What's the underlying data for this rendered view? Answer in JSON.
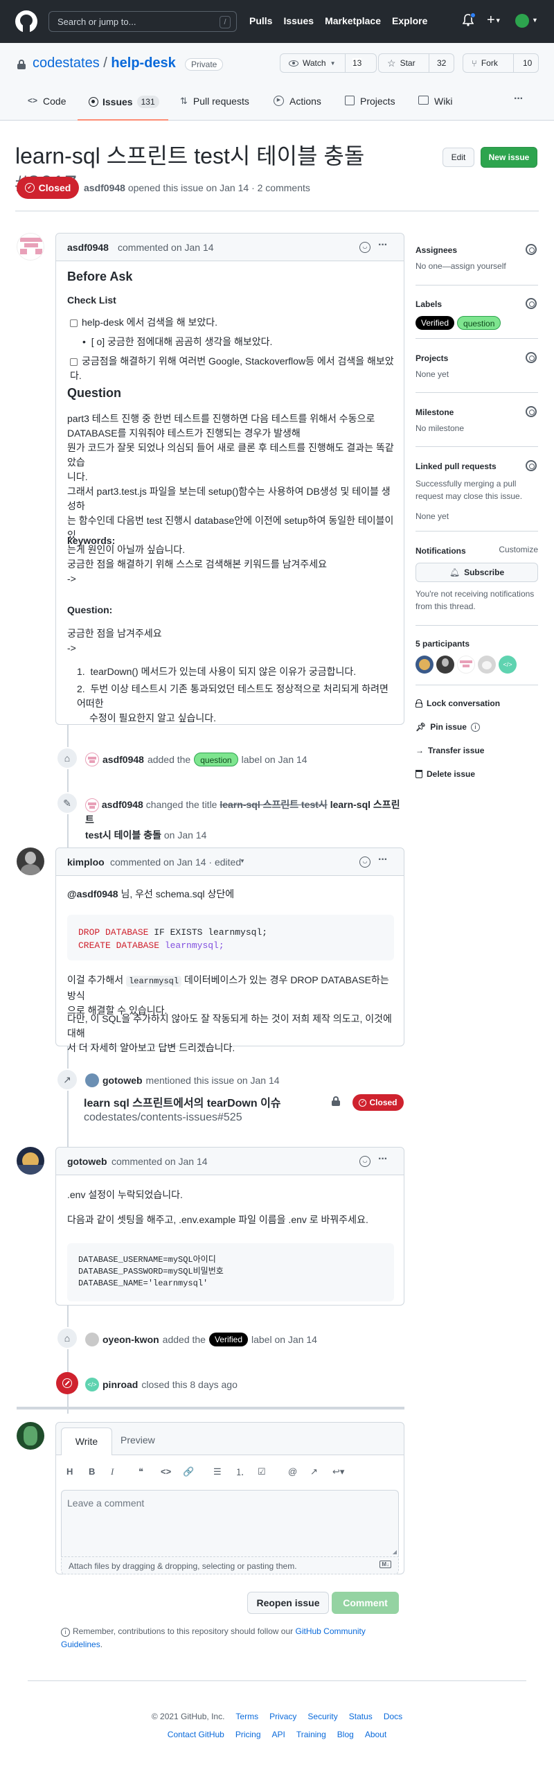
{
  "header": {
    "search_placeholder": "Search or jump to...",
    "slash": "/",
    "nav": [
      "Pulls",
      "Issues",
      "Marketplace",
      "Explore"
    ]
  },
  "repo": {
    "owner": "codestates",
    "separator": "/",
    "name": "help-desk",
    "visibility": "Private",
    "watch_label": "Watch",
    "watch_count": "13",
    "star_label": "Star",
    "star_count": "32",
    "fork_label": "Fork",
    "fork_count": "10"
  },
  "tabs": [
    {
      "label": "Code"
    },
    {
      "label": "Issues",
      "count": "131"
    },
    {
      "label": "Pull requests"
    },
    {
      "label": "Actions"
    },
    {
      "label": "Projects"
    },
    {
      "label": "Wiki"
    }
  ],
  "issue": {
    "title": "learn-sql 스프린트 test시 테이블 충돌",
    "number": "#2617",
    "edit_label": "Edit",
    "new_issue_label": "New issue",
    "state": "Closed",
    "author": "asdf0948",
    "meta": "opened this issue on Jan 14 · 2 comments"
  },
  "first_comment": {
    "author": "asdf0948",
    "when": "commented on Jan 14",
    "h_before": "Before Ask",
    "h_checklist": "Check List",
    "check1": "help-desk 에서 검색을 해 보았다.",
    "check2": "[ o] 궁금한 점에대해 곰곰히 생각을 해보았다.",
    "check3": "궁금점을 해결하기 위해 여러번 Google, Stackoverflow등 에서 검색을 해보았다.",
    "h_question": "Question",
    "q_line1": "part3 테스트 진행 중 한번 테스트를 진행하면 다음 테스트를 위해서 수동으로",
    "q_line2": "DATABASE를 지워줘야 테스트가 진행되는 경우가 발생해",
    "q_line3": "뭔가 코드가 잘못 되었나 의심되 들어 새로 클론 후 테스트를 진행해도 결과는 똑같았습",
    "q_line4": "니다.",
    "q_line5": "그래서 part3.test.js 파일을 보는데 setup()함수는 사용하여 DB생성 및 테이블 생성하",
    "q_line6": "는 함수인데 다음번 test 진행시 database안에 이전에 setup하여 동일한 테이블이 있",
    "q_line7": "는게 원인이 아닐까 싶습니다.",
    "h_keywords": "keywords:",
    "kw_text": "궁금한 점을 해결하기 위해 스스로 검색해본 키워드를 남겨주세요",
    "arrow1": "->",
    "h_question2": "Question:",
    "q2_text": "궁금한 점을 남겨주세요",
    "arrow2": "->",
    "ol1": "tearDown() 메서드가 있는데 사용이 되지 않은 이유가 궁금합니다.",
    "ol2a": "두번 이상 테스트시 기존 통과되었던 테스트도 정상적으로 처리되게 하려면 어떠한",
    "ol2b": "수정이 필요한지 알고 싶습니다."
  },
  "event_label": {
    "author": "asdf0948",
    "pre": "added the",
    "label": "question",
    "post": "label on Jan 14"
  },
  "event_rename": {
    "author": "asdf0948",
    "pre": "changed the title",
    "old": "learn-sql 스프린트 test시",
    "new": "learn-sql 스프린트",
    "new2": "test시 테이블 충돌",
    "post": "on Jan 14"
  },
  "kimploo": {
    "author": "kimploo",
    "when": "commented on Jan 14 · edited",
    "line1_mention": "@asdf0948",
    "line1_rest": " 님, 우선 schema.sql 상단에",
    "code1_kw": "DROP DATABASE",
    "code1_rest": " IF EXISTS learnmysql;",
    "code2_kw": "CREATE DATABASE",
    "code2_rest": " learnmysql;",
    "p2_a": "이걸 추가해서 ",
    "p2_code": "learnmysql",
    "p2_b": " 데이터베이스가 있는 경우 DROP DATABASE하는 방식",
    "p2_c": "으로 해결할 수 있습니다.",
    "p3_a": "다만, 이 SQL을 추가하지 않아도 잘 작동되게 하는 것이 저희 제작 의도고, 이것에 대해",
    "p3_b": "서 더 자세히 알아보고 답변 드리겠습니다."
  },
  "mention": {
    "author": "gotoweb",
    "text": "mentioned this issue on Jan 14",
    "ref_title": "learn sql 스프린트에서의 tearDown 이슈",
    "ref_repo": "codestates/contents-issues#525",
    "ref_state": "Closed"
  },
  "gotoweb": {
    "author": "gotoweb",
    "when": "commented on Jan 14",
    "p1": ".env 설정이 누락되었습니다.",
    "p2": "다음과 같이 셋팅을 해주고, .env.example 파일 이름을 .env 로 바꿔주세요.",
    "code1": "DATABASE_USERNAME=mySQL아이디",
    "code2": "DATABASE_PASSWORD=mySQL비밀번호",
    "code3": "DATABASE_NAME='learnmysql'"
  },
  "event_verified": {
    "author": "oyeon-kwon",
    "pre": "added the",
    "label": "Verified",
    "post": "label on Jan 14"
  },
  "event_closed": {
    "author": "pinroad",
    "text": "closed this 8 days ago"
  },
  "composer": {
    "tab_write": "Write",
    "tab_preview": "Preview",
    "placeholder": "Leave a comment",
    "attach": "Attach files by dragging & dropping, selecting or pasting them.",
    "reopen": "Reopen issue",
    "comment": "Comment",
    "remember_pre": "Remember, contributions to this repository should follow our ",
    "remember_link": "GitHub Community",
    "remember_link2": "Guidelines",
    "remember_post": "."
  },
  "sidebar": {
    "assignees": "Assignees",
    "assignees_val": "No one—assign yourself",
    "labels": "Labels",
    "label1": "Verified",
    "label2": "question",
    "projects": "Projects",
    "projects_val": "None yet",
    "milestone": "Milestone",
    "milestone_val": "No milestone",
    "linked": "Linked pull requests",
    "linked_desc1": "Successfully merging a pull",
    "linked_desc2": "request may close this issue.",
    "linked_val": "None yet",
    "notifications": "Notifications",
    "customize": "Customize",
    "subscribe": "Subscribe",
    "notif_desc1": "You're not receiving notifications",
    "notif_desc2": "from this thread.",
    "participants": "5 participants",
    "lock": "Lock conversation",
    "pin": "Pin issue",
    "transfer": "Transfer issue",
    "delete": "Delete issue"
  },
  "footer": {
    "copyright": "© 2021 GitHub, Inc.",
    "row1": [
      "Terms",
      "Privacy",
      "Security",
      "Status",
      "Docs"
    ],
    "row2": [
      "Contact GitHub",
      "Pricing",
      "API",
      "Training",
      "Blog",
      "About"
    ]
  },
  "colors": {
    "header_bg": "#24292f",
    "closed_red": "#cf222e",
    "green": "#2da44e",
    "link": "#0969da",
    "tab_accent": "#fd8c73"
  }
}
